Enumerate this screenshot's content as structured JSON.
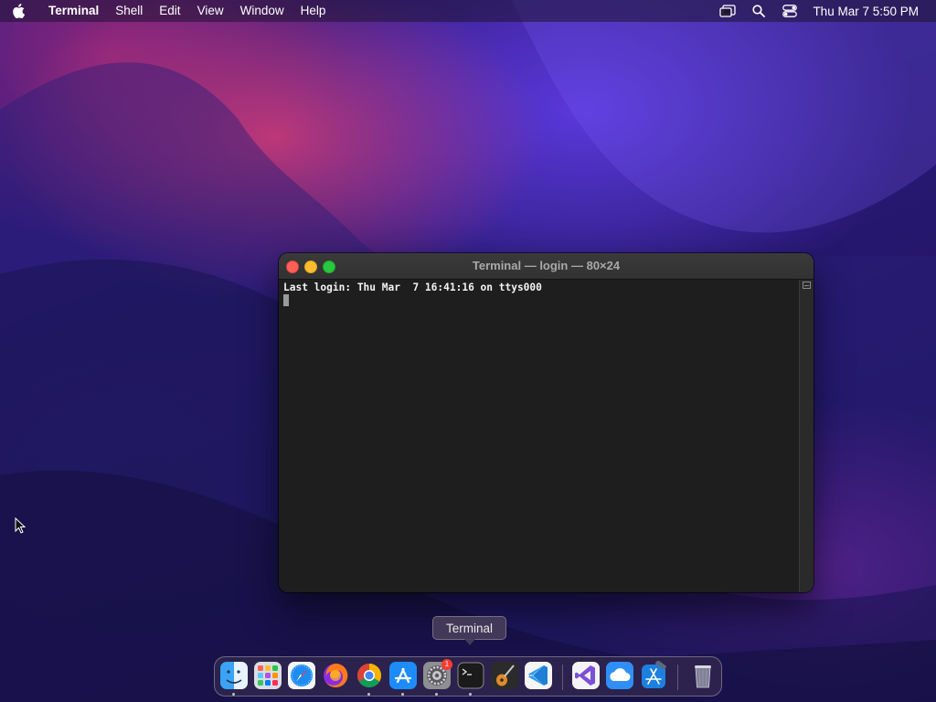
{
  "menubar": {
    "app_name": "Terminal",
    "items": [
      "Shell",
      "Edit",
      "View",
      "Window",
      "Help"
    ],
    "clock": "Thu Mar 7  5:50 PM"
  },
  "window": {
    "title": "Terminal — login — 80×24",
    "lines": [
      "Last login: Thu Mar  7 16:41:16 on ttys000"
    ]
  },
  "tooltip": {
    "label": "Terminal"
  },
  "dock": {
    "apps": [
      {
        "name": "finder-icon",
        "running": true
      },
      {
        "name": "launchpad-icon",
        "running": false
      },
      {
        "name": "safari-icon",
        "running": false
      },
      {
        "name": "firefox-icon",
        "running": false
      },
      {
        "name": "chrome-icon",
        "running": true
      },
      {
        "name": "app-store-icon",
        "running": true
      },
      {
        "name": "system-settings-icon",
        "running": true,
        "badge": "1"
      },
      {
        "name": "terminal-icon",
        "running": true
      },
      {
        "name": "garageband-icon",
        "running": false
      },
      {
        "name": "vscode-icon",
        "running": false
      },
      {
        "name": "visual-studio-icon",
        "running": false
      },
      {
        "name": "cloud-app-icon",
        "running": false
      },
      {
        "name": "xcode-icon",
        "running": false
      },
      {
        "name": "trash-icon",
        "running": false
      }
    ]
  },
  "colors": {
    "close": "#fe5f57",
    "minimize": "#febc2e",
    "zoom": "#28c840",
    "terminal_bg": "#1e1e1e"
  }
}
